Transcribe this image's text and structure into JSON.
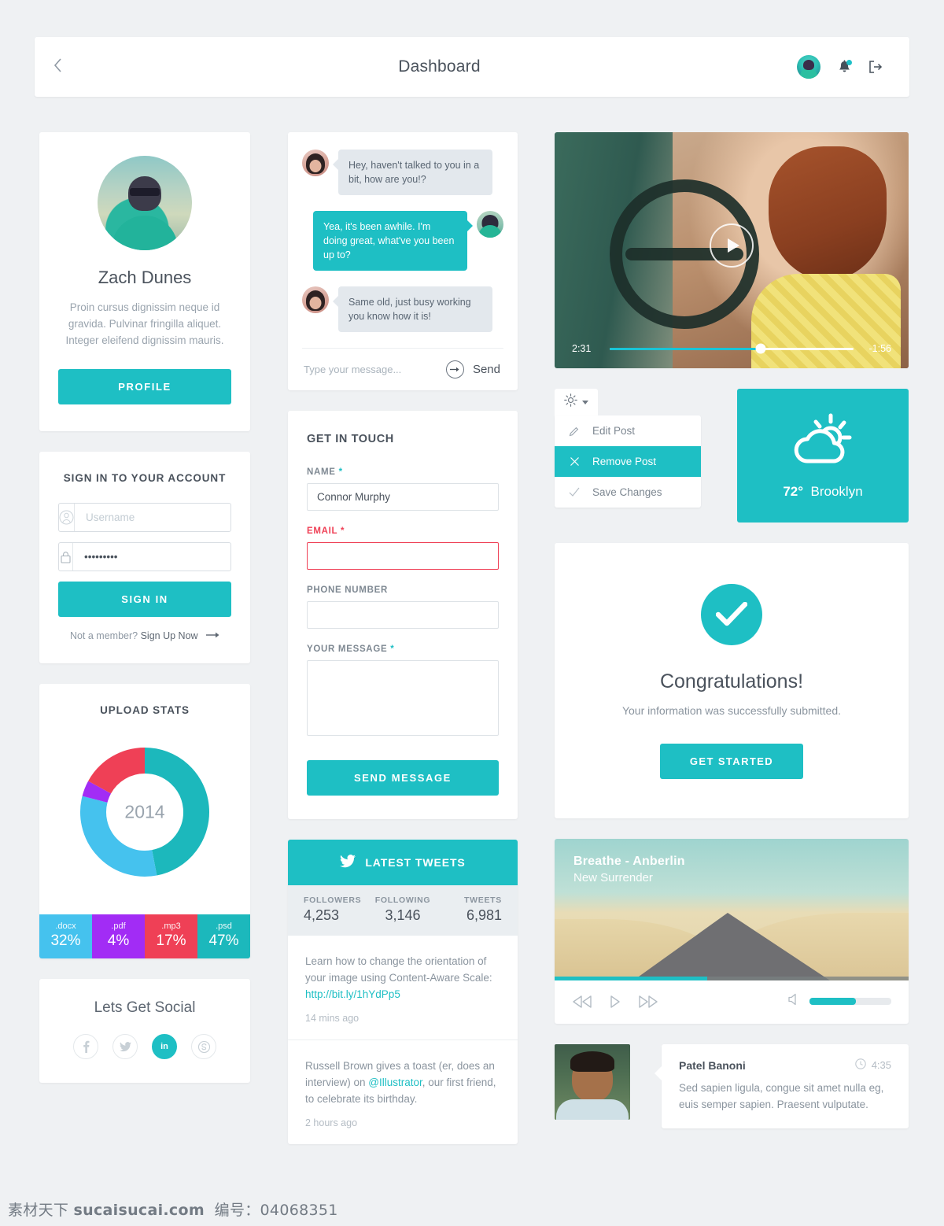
{
  "header": {
    "title": "Dashboard",
    "back_icon": "chevron-left-icon",
    "avatar_icon": "user-avatar",
    "bell_icon": "bell-icon",
    "logout_icon": "logout-icon"
  },
  "profile": {
    "name": "Zach Dunes",
    "bio": "Proin cursus dignissim neque id gravida. Pulvinar fringilla aliquet. Integer eleifend dignissim mauris.",
    "button": "PROFILE"
  },
  "signin": {
    "title": "SIGN IN TO YOUR ACCOUNT",
    "username_placeholder": "Username",
    "username_value": "",
    "password_value": "•••••••••",
    "button": "SIGN IN",
    "footer_prefix": "Not a member?",
    "footer_link": "Sign Up Now",
    "arrow": "arrow-right-icon"
  },
  "upload_stats": {
    "title": "UPLOAD STATS",
    "center_label": "2014",
    "legend": [
      {
        "ext": ".docx",
        "pct": "32%",
        "color": "#45c2ee"
      },
      {
        "ext": ".pdf",
        "pct": "4%",
        "color": "#a22cf5"
      },
      {
        "ext": ".mp3",
        "pct": "17%",
        "color": "#ef4056"
      },
      {
        "ext": ".psd",
        "pct": "47%",
        "color": "#1cb8bc"
      }
    ]
  },
  "chart_data": {
    "type": "pie",
    "title": "UPLOAD STATS",
    "center_label": "2014",
    "categories": [
      ".psd",
      ".docx",
      ".pdf",
      ".mp3"
    ],
    "values": [
      47,
      32,
      4,
      17
    ],
    "colors": [
      "#1cb8bc",
      "#45c2ee",
      "#a22cf5",
      "#ef4056"
    ],
    "unit": "%",
    "donut": true,
    "inner_radius_ratio": 0.62,
    "start_angle": 0,
    "legend_position": "bottom",
    "legend_entries": [
      ".docx 32%",
      ".pdf 4%",
      ".mp3 17%",
      ".psd 47%"
    ]
  },
  "social": {
    "title": "Lets Get Social",
    "items": [
      {
        "name": "facebook-icon",
        "glyph": "f",
        "active": false
      },
      {
        "name": "twitter-icon",
        "glyph": "t",
        "active": false
      },
      {
        "name": "linkedin-icon",
        "glyph": "in",
        "active": true
      },
      {
        "name": "skype-icon",
        "glyph": "s",
        "active": false
      }
    ]
  },
  "chat": {
    "messages": [
      {
        "from": "them",
        "text": "Hey, haven't talked to you in a bit, how are you!?"
      },
      {
        "from": "me",
        "text": "Yea, it's been awhile. I'm doing great, what've you been up to?"
      },
      {
        "from": "them",
        "text": "Same old, just busy working you know how it is!"
      }
    ],
    "input_placeholder": "Type your message...",
    "input_value": "",
    "send_label": "Send",
    "send_icon": "arrow-right-circle-icon"
  },
  "get_in_touch": {
    "title": "GET IN TOUCH",
    "fields": [
      {
        "label": "NAME",
        "required": true,
        "value": "Connor Murphy",
        "error": false
      },
      {
        "label": "EMAIL",
        "required": true,
        "value": "",
        "error": true
      },
      {
        "label": "PHONE NUMBER",
        "required": false,
        "value": "",
        "error": false
      },
      {
        "label": "YOUR MESSAGE",
        "required": true,
        "value": "",
        "error": false
      }
    ],
    "submit": "SEND MESSAGE"
  },
  "tweets": {
    "header": "LATEST TWEETS",
    "twitter_icon": "twitter-bird-icon",
    "stats": [
      {
        "label": "FOLLOWERS",
        "value": "4,253"
      },
      {
        "label": "FOLLOWING",
        "value": "3,146"
      },
      {
        "label": "TWEETS",
        "value": "6,981"
      }
    ],
    "items": [
      {
        "text_before": "Learn how to change the orientation of your image using Content-Aware Scale: ",
        "link": "http://bit.ly/1hYdPp5",
        "text_after": "",
        "time": "14 mins ago"
      },
      {
        "text_before": "Russell Brown gives a toast (er, does an interview) on ",
        "link": "@Illustrator",
        "text_after": ", our first friend, to celebrate its birthday.",
        "time": "2 hours ago"
      }
    ]
  },
  "video": {
    "play_icon": "play-icon",
    "elapsed": "2:31",
    "remaining": "-1:56",
    "progress_pct": 62
  },
  "dropdown": {
    "gear_icon": "gear-icon",
    "caret_icon": "chevron-down-icon",
    "items": [
      {
        "label": "Edit Post",
        "icon": "pencil-icon",
        "active": false
      },
      {
        "label": "Remove Post",
        "icon": "close-icon",
        "active": true
      },
      {
        "label": "Save Changes",
        "icon": "check-icon",
        "active": false
      }
    ]
  },
  "weather": {
    "icon": "sun-cloud-icon",
    "temperature": "72°",
    "city": "Brooklyn",
    "color": "#1ebfc4"
  },
  "congrats": {
    "icon": "check-circle-icon",
    "heading": "Congratulations!",
    "subtext": "Your information was successfully submitted.",
    "button": "GET STARTED"
  },
  "music": {
    "title": "Breathe - Anberlin",
    "album": "New Surrender",
    "seek_pct": 43,
    "volume_pct": 57,
    "controls": [
      {
        "name": "rewind-icon"
      },
      {
        "name": "play-icon"
      },
      {
        "name": "fast-forward-icon"
      }
    ],
    "volume_icon": "volume-icon"
  },
  "comment": {
    "name": "Patel Banoni",
    "time": "4:35",
    "clock_icon": "clock-icon",
    "body": "Sed sapien ligula, congue sit amet nulla eg, euis semper sapien. Praesent vulputate."
  },
  "watermark": {
    "prefix": "素材天下",
    "site": "sucaisucai.com",
    "code_label": "编号：",
    "code": "04068351"
  },
  "theme": {
    "accent": "#1ebfc4",
    "danger": "#ef4056",
    "bg": "#eff1f3",
    "text_dark": "#4a525c",
    "text_muted": "#8b959f"
  }
}
